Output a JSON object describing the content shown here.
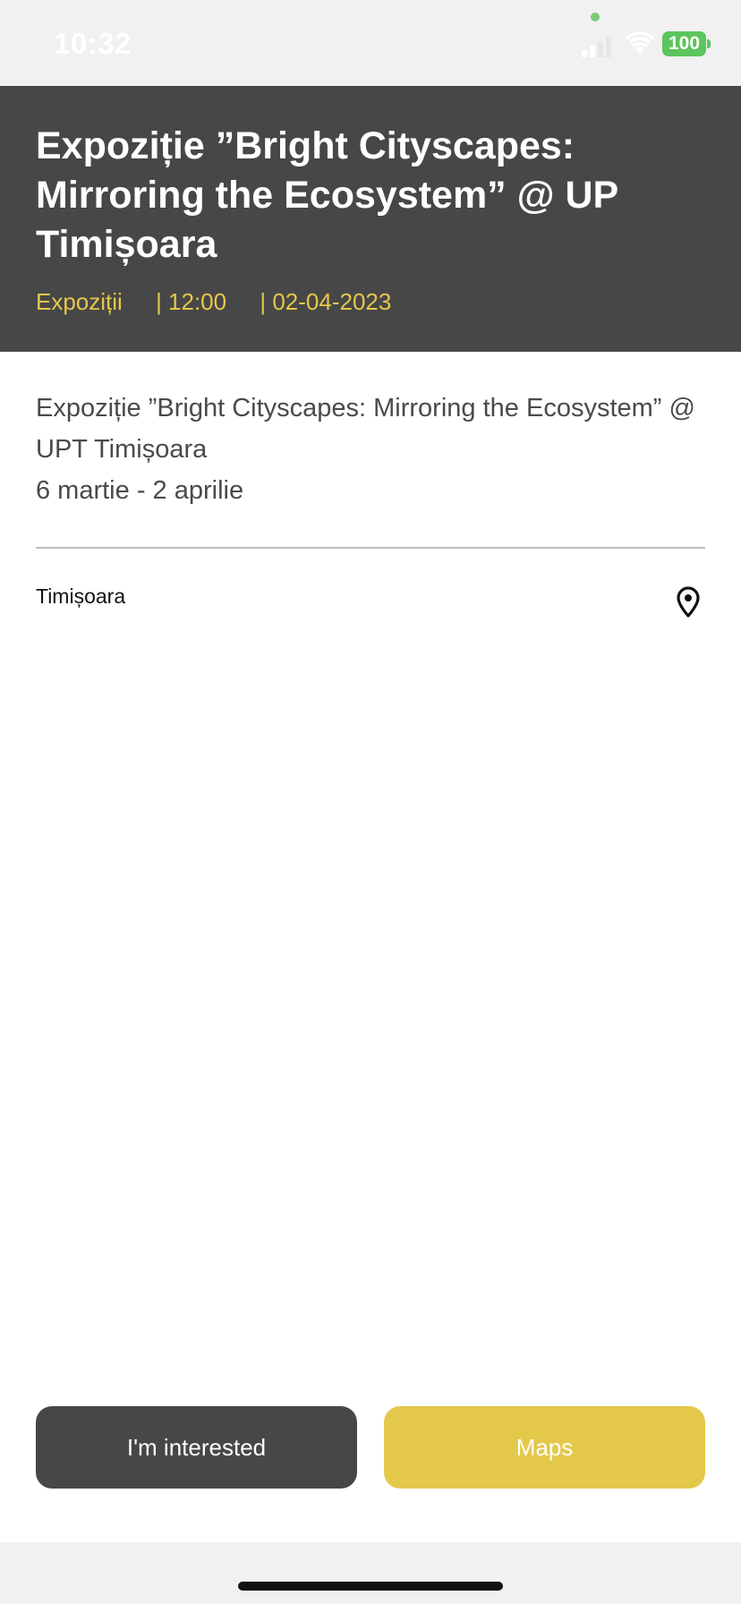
{
  "status_bar": {
    "time": "10:32",
    "battery_level": "100",
    "colors": {
      "privacy_dot": "#7ccc7a",
      "battery": "#5cc55c"
    },
    "icons": [
      "signal-icon",
      "wifi-icon",
      "battery-icon"
    ]
  },
  "event": {
    "title": "Expoziție ”Bright Cityscapes: Mirroring the Ecosystem” @ UP Timișoara",
    "category": "Expoziții",
    "time": "| 12:00",
    "date": "| 02-04-2023",
    "description_line1": "Expoziție ”Bright Cityscapes: Mirroring the Ecosystem” @ UPT Timișoara",
    "description_line2": "6 martie - 2 aprilie",
    "location": "Timișoara"
  },
  "actions": {
    "interested_label": "I'm interested",
    "maps_label": "Maps"
  },
  "colors": {
    "header_bg": "#474747",
    "accent": "#e4c84a",
    "page_bg": "#ffffff"
  }
}
